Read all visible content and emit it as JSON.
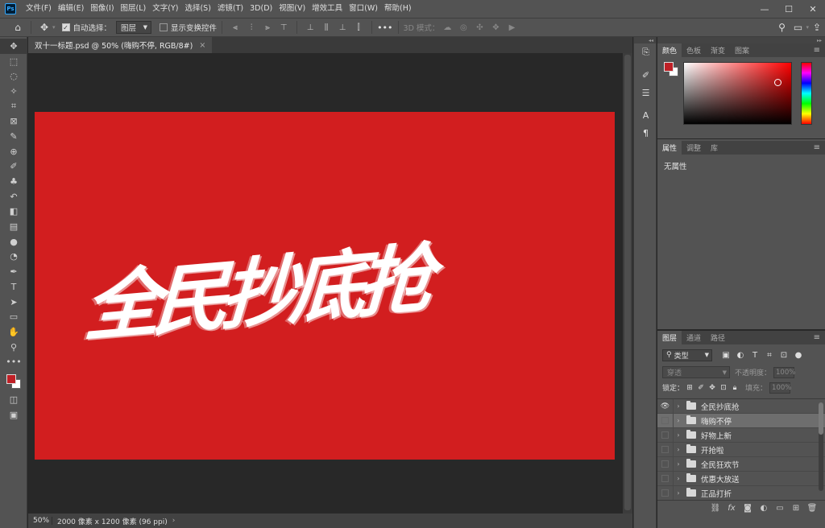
{
  "menubar": {
    "items": [
      "文件(F)",
      "编辑(E)",
      "图像(I)",
      "图层(L)",
      "文字(Y)",
      "选择(S)",
      "滤镜(T)",
      "3D(D)",
      "视图(V)",
      "增效工具",
      "窗口(W)",
      "帮助(H)"
    ],
    "min": "—",
    "max": "☐",
    "close": "✕"
  },
  "options": {
    "auto_select_label": "自动选择：",
    "auto_select_value": "图层",
    "show_transform_label": "显示变换控件",
    "more": "•••",
    "mode3d_label": "3D 模式："
  },
  "tools": [
    {
      "name": "move-tool",
      "icon": "✥"
    },
    {
      "name": "marquee-tool",
      "icon": "⬚"
    },
    {
      "name": "lasso-tool",
      "icon": "◌"
    },
    {
      "name": "magic-wand-tool",
      "icon": "✧"
    },
    {
      "name": "crop-tool",
      "icon": "⌗"
    },
    {
      "name": "frame-tool",
      "icon": "⊠"
    },
    {
      "name": "eyedropper-tool",
      "icon": "✎"
    },
    {
      "name": "healing-tool",
      "icon": "⊕"
    },
    {
      "name": "brush-tool",
      "icon": "✐"
    },
    {
      "name": "stamp-tool",
      "icon": "♣"
    },
    {
      "name": "history-brush-tool",
      "icon": "↶"
    },
    {
      "name": "eraser-tool",
      "icon": "◧"
    },
    {
      "name": "gradient-tool",
      "icon": "▤"
    },
    {
      "name": "blur-tool",
      "icon": "●"
    },
    {
      "name": "dodge-tool",
      "icon": "◔"
    },
    {
      "name": "pen-tool",
      "icon": "✒"
    },
    {
      "name": "type-tool",
      "icon": "T"
    },
    {
      "name": "path-select-tool",
      "icon": "➤"
    },
    {
      "name": "shape-tool",
      "icon": "▭"
    },
    {
      "name": "hand-tool",
      "icon": "✋"
    },
    {
      "name": "zoom-tool",
      "icon": "⚲"
    },
    {
      "name": "more-tools",
      "icon": "•••"
    }
  ],
  "document": {
    "tab_title": "双十一标题.psd @ 50% (嗨购不停, RGB/8#)",
    "tab_close": "×",
    "headline": "全民抄底抢",
    "canvas_color": "#d21e1f"
  },
  "status": {
    "zoom": "50%",
    "info": "2000 像素 x 1200 像素 (96 ppi)",
    "arrow": "›"
  },
  "color_panel": {
    "tabs": [
      "颜色",
      "色板",
      "渐变",
      "图案"
    ],
    "foreground": "#bf2026",
    "background": "#ffffff"
  },
  "properties_panel": {
    "tabs": [
      "属性",
      "调整",
      "库"
    ],
    "content": "无属性"
  },
  "layers_panel": {
    "tabs": [
      "图层",
      "通道",
      "路径"
    ],
    "kind_label": "类型",
    "blend_mode": "穿透",
    "opacity_label": "不透明度：",
    "opacity_value": "100%",
    "lock_label": "锁定：",
    "fill_label": "填充：",
    "fill_value": "100%",
    "layers": [
      {
        "name": "全民抄底抢",
        "visible": true,
        "selected": false
      },
      {
        "name": "嗨购不停",
        "visible": false,
        "selected": true
      },
      {
        "name": "好物上新",
        "visible": false,
        "selected": false
      },
      {
        "name": "开抢啦",
        "visible": false,
        "selected": false
      },
      {
        "name": "全民狂欢节",
        "visible": false,
        "selected": false
      },
      {
        "name": "优惠大放送",
        "visible": false,
        "selected": false
      },
      {
        "name": "正品打折",
        "visible": false,
        "selected": false
      }
    ]
  }
}
